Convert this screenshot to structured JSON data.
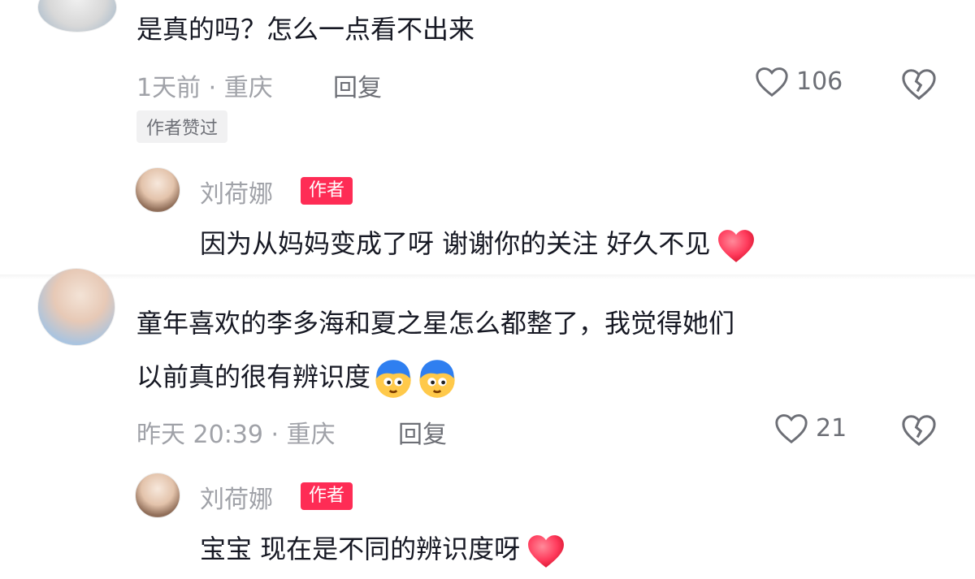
{
  "comment1": {
    "text": "是真的吗？怎么一点看不出来",
    "meta": "1天前 · 重庆",
    "reply": "回复",
    "likes": "106",
    "badge": "作者赞过"
  },
  "reply1": {
    "author": "刘荷娜",
    "tag": "作者",
    "text": "因为从妈妈变成了呀 谢谢你的关注 好久不见"
  },
  "comment2": {
    "text_line1": "童年喜欢的李多海和夏之星怎么都整了，我觉得她们",
    "text_line2": "以前真的很有辨识度",
    "meta": "昨天 20:39 · 重庆",
    "reply": "回复",
    "likes": "21"
  },
  "reply2": {
    "author": "刘荷娜",
    "tag": "作者",
    "text": "宝宝 现在是不同的辨识度呀"
  },
  "icons": {
    "like": "heart-outline-icon",
    "dislike": "broken-heart-icon",
    "emoji_heart": "red-heart-emoji",
    "emoji_face": "blue-hair-face-emoji"
  },
  "colors": {
    "author_tag": "#fe2c55",
    "heart": "#ff3b5c",
    "muted": "#a0a2a8"
  }
}
